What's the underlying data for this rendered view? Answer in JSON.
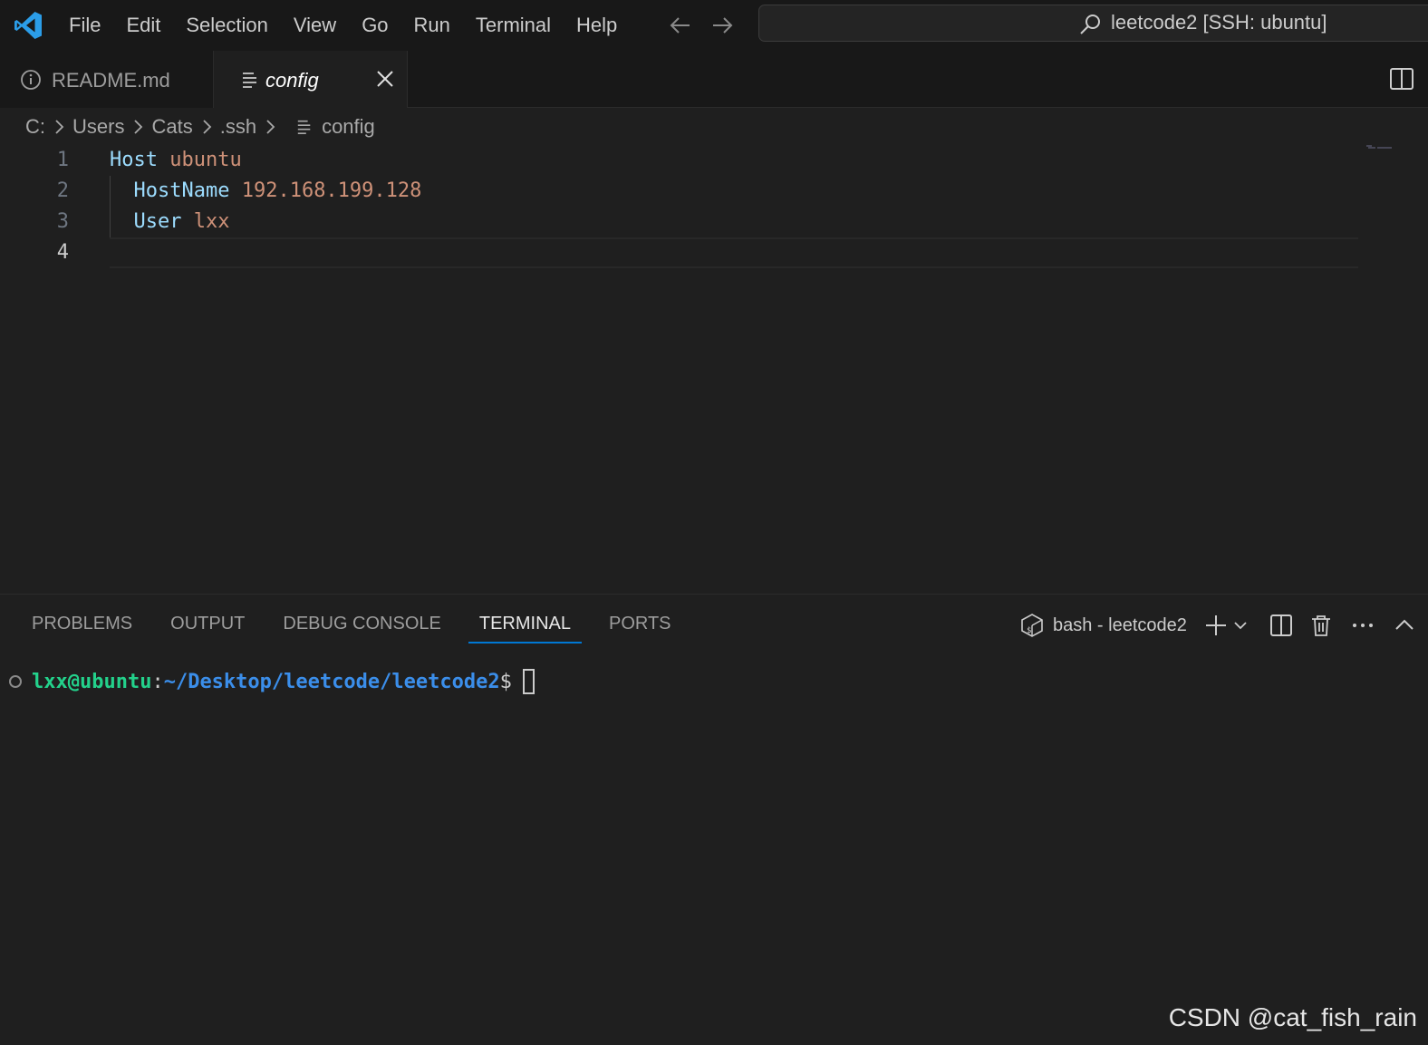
{
  "menu": {
    "items": [
      "File",
      "Edit",
      "Selection",
      "View",
      "Go",
      "Run",
      "Terminal",
      "Help"
    ]
  },
  "command_center": {
    "text": "leetcode2 [SSH: ubuntu]"
  },
  "tabs": [
    {
      "label": "README.md",
      "icon": "info-icon",
      "active": false
    },
    {
      "label": "config",
      "icon": "file-lines-icon",
      "active": true
    }
  ],
  "breadcrumb": {
    "parts": [
      "C:",
      "Users",
      "Cats",
      ".ssh",
      "config"
    ]
  },
  "editor": {
    "lines": [
      {
        "number": "1",
        "key": "Host",
        "value": "ubuntu",
        "indent": false
      },
      {
        "number": "2",
        "key": "HostName",
        "value": "192.168.199.128",
        "indent": true
      },
      {
        "number": "3",
        "key": "User",
        "value": "lxx",
        "indent": true
      },
      {
        "number": "4",
        "key": "",
        "value": "",
        "indent": false
      }
    ],
    "colors": {
      "key": "#9cdcfe",
      "value": "#ce9178"
    }
  },
  "panel": {
    "tabs": [
      "PROBLEMS",
      "OUTPUT",
      "DEBUG CONSOLE",
      "TERMINAL",
      "PORTS"
    ],
    "active_tab": "TERMINAL",
    "terminal_name": "bash - leetcode2"
  },
  "terminal": {
    "user_host": "lxx@ubuntu",
    "colon": ":",
    "path": "~/Desktop/leetcode/leetcode2",
    "prompt": "$"
  },
  "watermark": "CSDN @cat_fish_rain",
  "accent_color": "#0078d4"
}
